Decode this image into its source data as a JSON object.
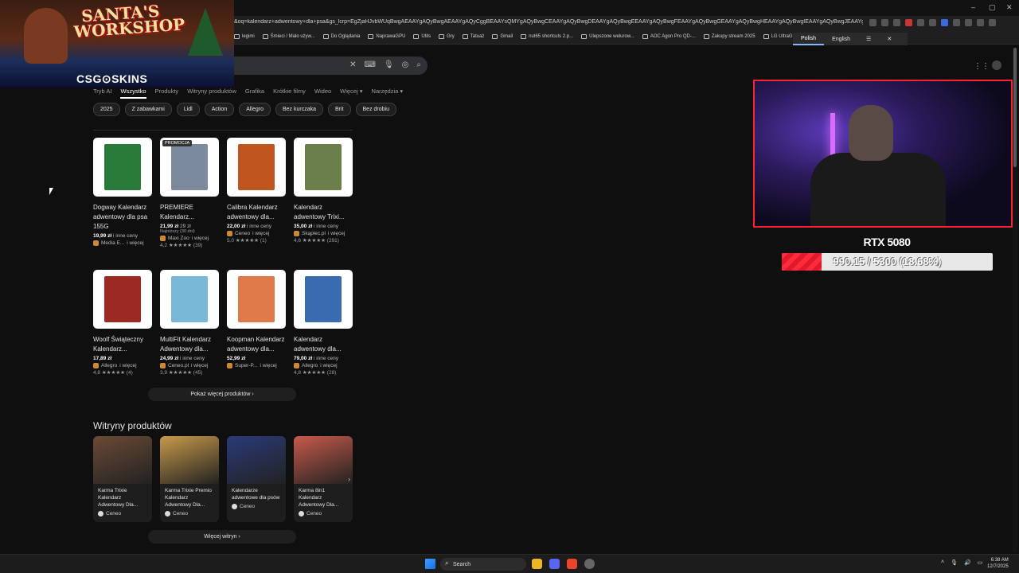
{
  "browser": {
    "url": "&oq=kalendarz+adwentowy+dla+psa&gs_lcrp=EgZjaHJvbWUqBwgAEAAYgAQyBwgAEAAYgAQyCggBEAAYsQMYgAQyBwgCEAAYgAQyBwgDEAAYgAQyBwgEEAAYgAQyBwgFEAAYgAQyBwgGEAAYgAQyBwgHEAAYgAQyBwgIEAAYgAQyBwgJEAAYgATSAQgzN...",
    "bookmarks": [
      "legimi",
      "Śmieci / Mało używ...",
      "Do Oglądania",
      "NaprawaGPU",
      "Utils",
      "Gry",
      "Tatuaż",
      "Gmail",
      "nut65 shortcuts 2.p...",
      "Ulepszone welurow...",
      "AOC Agon Pro QD-...",
      "Zakupy stream 2025",
      "LG UltraG"
    ],
    "translate": {
      "lang1": "Polish",
      "lang2": "English"
    }
  },
  "promo": {
    "title": "SANTA'S WORKSHOP",
    "brand": "CSG⊙SKINS"
  },
  "search": {
    "tabs": [
      "Tryb AI",
      "Wszystko",
      "Produkty",
      "Witryny produktów",
      "Grafika",
      "Krótkie filmy",
      "Wideo",
      "Więcej ▾",
      "Narzędzia ▾"
    ]
  },
  "chips": [
    "2025",
    "Z zabawkami",
    "Lidl",
    "Action",
    "Allegro",
    "Bez kurczaka",
    "Brit",
    "Bez drobiu"
  ],
  "products": [
    {
      "title": "Dogway Kalendarz adwentowy dla psa 155G",
      "price": "19,99 zł",
      "price_note": "i inne ceny",
      "note": "",
      "shop": "Media E...",
      "shop_more": "i więcej",
      "rating": "",
      "color": "#2a7a3a"
    },
    {
      "title": "PREMIERE Kalendarz...",
      "price": "21,99 zł",
      "price_note": "29 zł",
      "note": "Najniższy (30 dni)",
      "shop": "Maxi Zoo",
      "shop_more": "i więcej",
      "rating": "4,2 ★★★★★ (39)",
      "color": "#7b8a9c",
      "badge": "PROMOCJA"
    },
    {
      "title": "Calibra Kalendarz adwentowy dla...",
      "price": "22,00 zł",
      "price_note": "i inne ceny",
      "note": "",
      "shop": "Ceneo",
      "shop_more": "i więcej",
      "rating": "5,0 ★★★★★ (1)",
      "color": "#c0561f"
    },
    {
      "title": "Kalendarz adwentowy Trixi...",
      "price": "35,00 zł",
      "price_note": "i inne ceny",
      "note": "",
      "shop": "Skąpiec.pl",
      "shop_more": "i więcej",
      "rating": "4,6 ★★★★★ (291)",
      "color": "#6b7f4a"
    },
    {
      "title": "Woolf Świąteczny Kalendarz...",
      "price": "17,89 zł",
      "price_note": "",
      "note": "",
      "shop": "Allegro",
      "shop_more": "i więcej",
      "rating": "4,8 ★★★★★ (4)",
      "color": "#9c2a22"
    },
    {
      "title": "MultiFit Kalendarz Adwentowy dla...",
      "price": "24,99 zł",
      "price_note": "i inne ceny",
      "note": "",
      "shop": "Ceneo.pl",
      "shop_more": "i więcej",
      "rating": "3,9 ★★★★★ (45)",
      "color": "#7ab8d8"
    },
    {
      "title": "Koopman Kalendarz adwentowy dla...",
      "price": "52,99 zł",
      "price_note": "",
      "note": "",
      "shop": "Super-P...",
      "shop_more": "i więcej",
      "rating": "",
      "color": "#e07a4a"
    },
    {
      "title": "Kalendarz adwentowy dla...",
      "price": "79,00 zł",
      "price_note": "i inne ceny",
      "note": "",
      "shop": "Allegro",
      "shop_more": "i więcej",
      "rating": "4,8 ★★★★★ (28)",
      "color": "#3a6ab0"
    }
  ],
  "more_products": "Pokaż więcej produktów ›",
  "sites_title": "Witryny produktów",
  "sites": [
    {
      "title": "Karma Trixie Kalendarz Adwentowy Dla...",
      "source": "Ceneo",
      "color": "#6a4a35"
    },
    {
      "title": "Karma Trixie Premio Kalendarz Adwentowy Dla...",
      "source": "Ceneo",
      "color": "#c89a4a"
    },
    {
      "title": "Kalendarze adwentowe dla psów",
      "source": "Ceneo",
      "color": "#2a3a7a"
    },
    {
      "title": "Karma 8in1 Kalendarz Adwentowy Dla...",
      "source": "Ceneo",
      "color": "#c85a4a"
    }
  ],
  "more_sites": "Więcej witryn ›",
  "goal": {
    "title": "RTX 5080",
    "text": "990.15 / 5300 (18.68%)",
    "progress_pct": 18.68
  },
  "taskbar": {
    "search": "Search",
    "time": "6:38 AM",
    "date": "12/7/2025"
  },
  "colors": {
    "accent": "#ff2233",
    "background": "#0f0f10"
  }
}
